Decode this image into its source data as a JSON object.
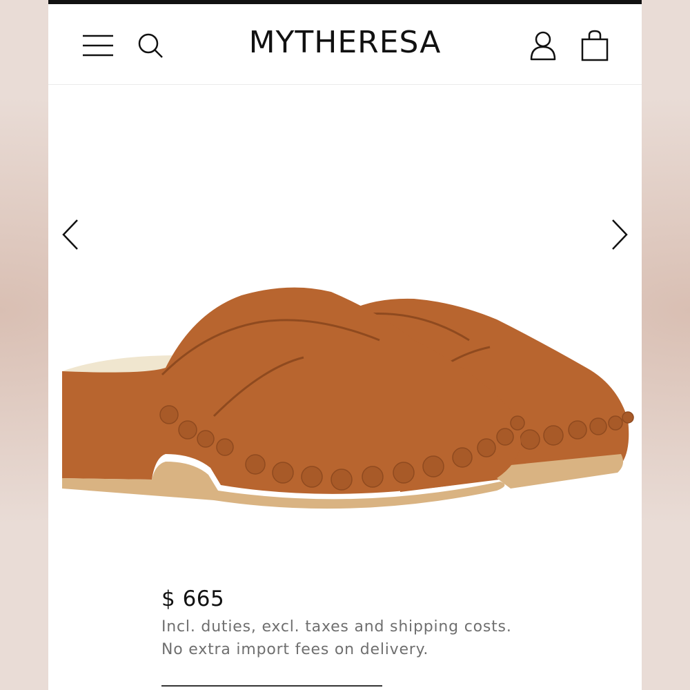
{
  "header": {
    "brand": "MYTHERESA",
    "icons": [
      "menu-icon",
      "search-icon",
      "account-icon",
      "shopping-bag-icon"
    ]
  },
  "gallery": {
    "prev_icon": "chevron-left-icon",
    "next_icon": "chevron-right-icon"
  },
  "product": {
    "price": "$ 665",
    "duties_note": "Incl. duties, excl. taxes and shipping costs.",
    "import_note": "No extra import fees on delivery."
  },
  "colors": {
    "suede": "#b8652f",
    "suede_shadow": "#8f4a1f",
    "sole": "#d9b382",
    "insole": "#f0e6cf",
    "accent": "#111111"
  }
}
